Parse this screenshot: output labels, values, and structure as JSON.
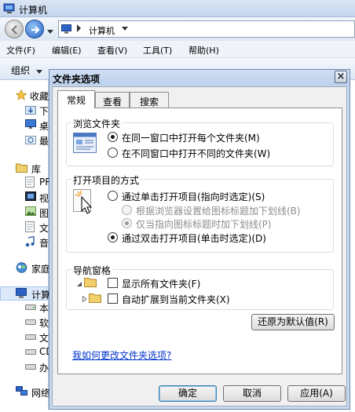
{
  "explorer": {
    "title": "计算机",
    "breadcrumb": "计算机",
    "menus": [
      "文件(F)",
      "编辑(E)",
      "查看(V)",
      "工具(T)",
      "帮助(H)"
    ],
    "organize": "组织",
    "nav": {
      "favorites": "收藏",
      "fav_items": [
        "下",
        "桌",
        "最"
      ],
      "libraries": "库",
      "lib_items": [
        "PR",
        "视",
        "图",
        "文",
        "音"
      ],
      "homegroup": "家庭",
      "computer": "计算",
      "comp_items": [
        "本",
        "软",
        "文",
        "CD",
        "办"
      ],
      "network": "网络"
    }
  },
  "dialog": {
    "title": "文件夹选项",
    "close_glyph": "×",
    "tabs": [
      "常规",
      "查看",
      "搜索"
    ],
    "browse_group": {
      "legend": "浏览文件夹",
      "opt1": "在同一窗口中打开每个文件夹(M)",
      "opt2": "在不同窗口中打开不同的文件夹(W)"
    },
    "click_group": {
      "legend": "打开项目的方式",
      "opt1": "通过单击打开项目(指向时选定)(S)",
      "sub1": "根据浏览器设置给图标标题加下划线(B)",
      "sub2": "仅当指向图标标题时加下划线(P)",
      "opt2": "通过双击打开项目(单击时选定)(D)"
    },
    "nav_group": {
      "legend": "导航窗格",
      "chk1": "显示所有文件夹(F)",
      "chk2": "自动扩展到当前文件夹(X)"
    },
    "restore_button": "还原为默认值(R)",
    "help_link": "我如何更改文件夹选项?",
    "ok": "确定",
    "cancel": "取消",
    "apply": "应用(A)"
  }
}
